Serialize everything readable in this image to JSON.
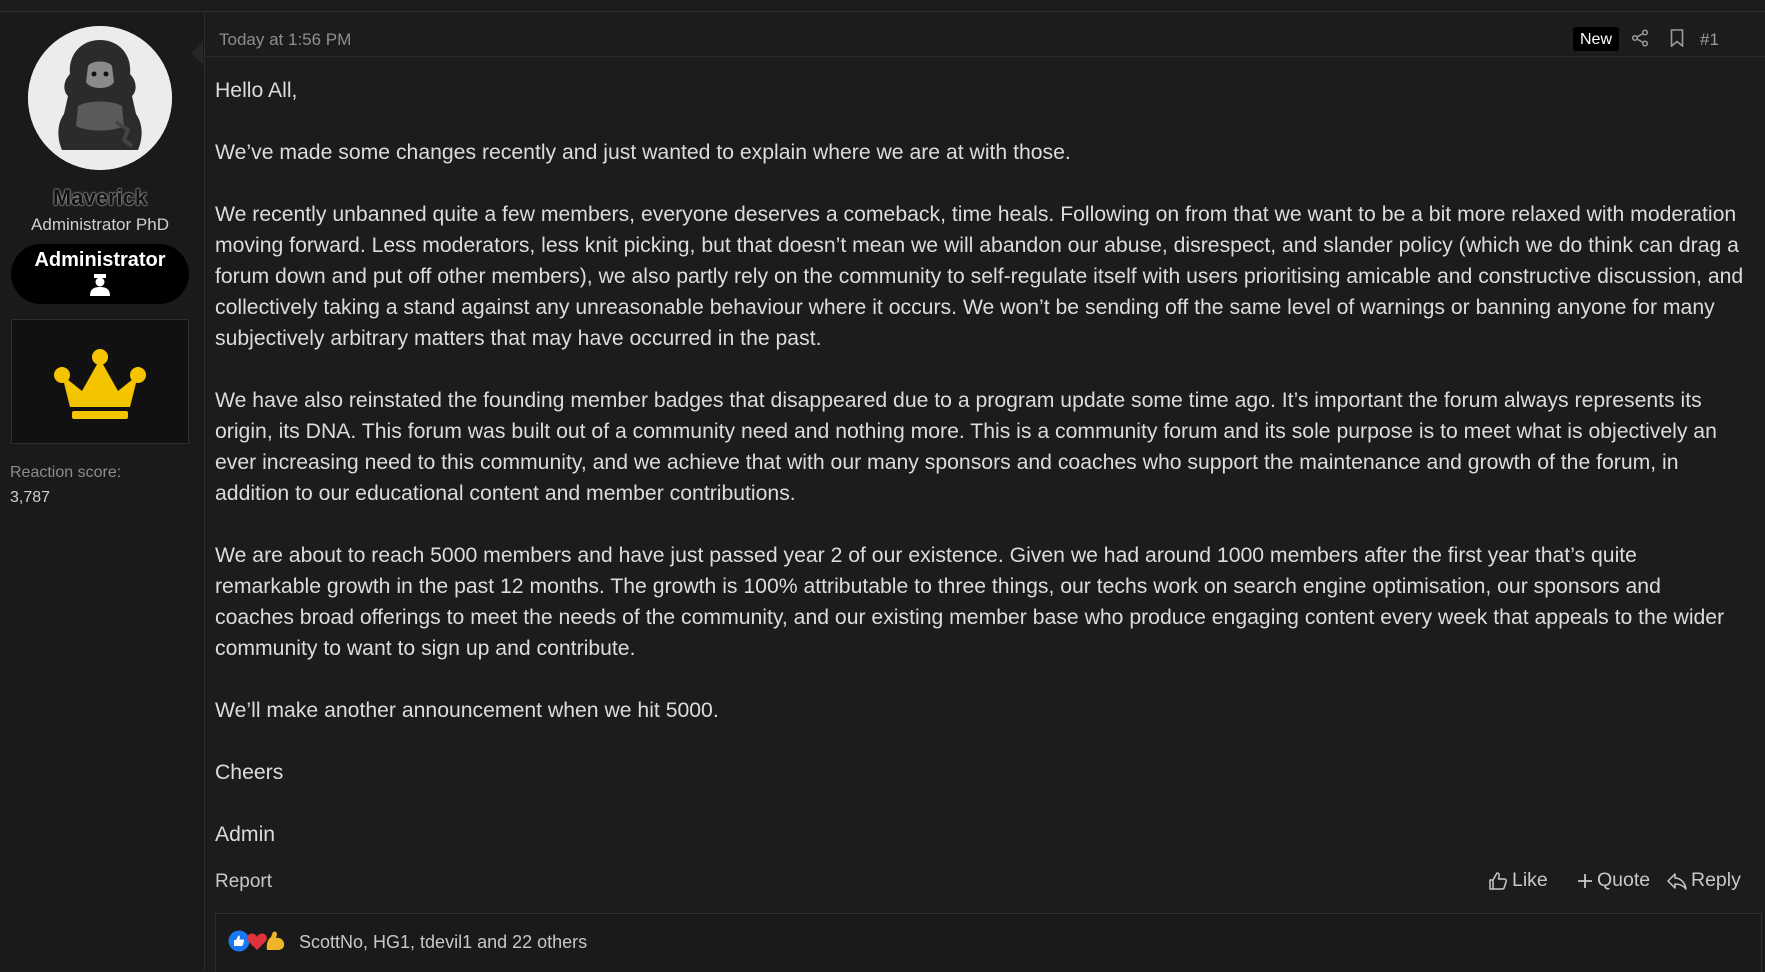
{
  "user": {
    "name": "Maverick",
    "title": "Administrator PhD",
    "banner": "Administrator",
    "reaction_label": "Reaction score:",
    "reaction_value": "3,787"
  },
  "post": {
    "timestamp": "Today at 1:56 PM",
    "badge": "New",
    "number": "#1",
    "paragraphs": [
      "Hello All,",
      "We’ve made some changes recently and just wanted to explain where we are at with those.",
      "We recently unbanned quite a few members, everyone deserves a comeback, time heals. Following on from that we want to be a bit more relaxed with moderation moving forward. Less moderators, less knit picking, but that doesn’t mean we will abandon our abuse, disrespect, and slander policy (which we do think can drag a forum down and put off other members), we also partly rely on the community to self-regulate itself with users prioritising amicable and constructive discussion, and collectively taking a stand against any unreasonable behaviour where it occurs. We won’t be sending off the same level of warnings or banning anyone for many subjectively arbitrary matters that may have occurred in the past.",
      "We have also reinstated the founding member badges that disappeared due to a program update some time ago. It’s important the forum always represents its origin, its DNA. This forum was built out of a community need and nothing more. This is a community forum and its sole purpose is to meet what is objectively an ever increasing need to this community, and we achieve that with our many sponsors and coaches who support the maintenance and growth of the forum, in addition to our educational content and member contributions.",
      "We are about to reach 5000 members and have just passed year 2 of our existence. Given we had around 1000 members after the first year that’s quite remarkable growth in the past 12 months. The growth is 100% attributable to three things, our techs work on search engine optimisation, our sponsors and coaches broad offerings to meet the needs of the community, and our existing member base who produce engaging content every week that appeals to the wider community to want to sign up and contribute.",
      "We’ll make another announcement when we hit 5000.",
      "Cheers",
      "Admin"
    ]
  },
  "footer": {
    "report": "Report",
    "like": "Like",
    "quote": "Quote",
    "reply": "Reply"
  },
  "reactions": {
    "icons": [
      "like-icon",
      "love-icon",
      "strong-arm-icon"
    ],
    "users": "ScottNo, HG1, tdevil1 and 22 others"
  },
  "colors": {
    "background": "#1c1c1c",
    "sidebar": "#1a1a1a",
    "crown": "#f5c400",
    "like_blue": "#1877f2",
    "love_red": "#e0323c"
  }
}
